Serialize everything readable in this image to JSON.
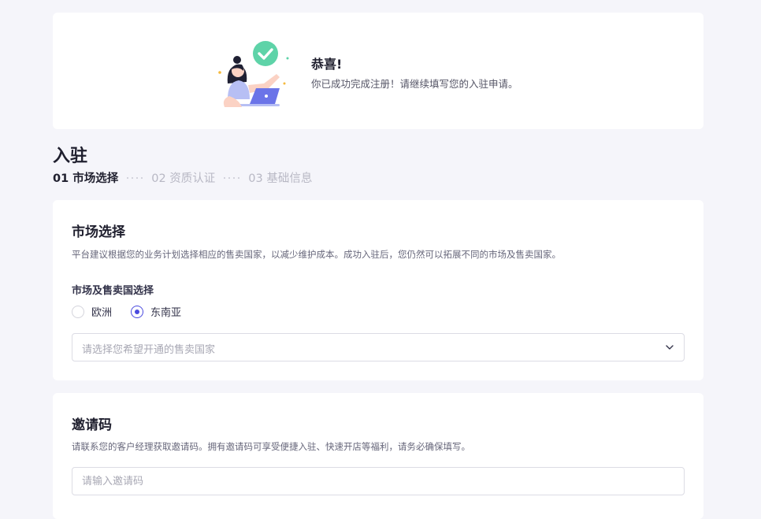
{
  "banner": {
    "title": "恭喜!",
    "description": "你已成功完成注册！请继续填写您的入驻申请。"
  },
  "page": {
    "title": "入驻"
  },
  "steps": [
    {
      "label": "01 市场选择",
      "active": true
    },
    {
      "label": "02 资质认证",
      "active": false
    },
    {
      "label": "03 基础信息",
      "active": false
    }
  ],
  "market": {
    "title": "市场选择",
    "description": "平台建议根据您的业务计划选择相应的售卖国家，以减少维护成本。成功入驻后，您仍然可以拓展不同的市场及售卖国家。",
    "field_label": "市场及售卖国选择",
    "options": [
      {
        "label": "欧洲",
        "checked": false
      },
      {
        "label": "东南亚",
        "checked": true
      }
    ],
    "select_placeholder": "请选择您希望开通的售卖国家"
  },
  "invite": {
    "title": "邀请码",
    "description": "请联系您的客户经理获取邀请码。拥有邀请码可享受便捷入驻、快速开店等福利，请务必确保填写。",
    "input_placeholder": "请输入邀请码",
    "input_value": ""
  },
  "colors": {
    "accent": "#4a4adf",
    "success": "#5ed3a8",
    "background": "#f5f5fa"
  }
}
